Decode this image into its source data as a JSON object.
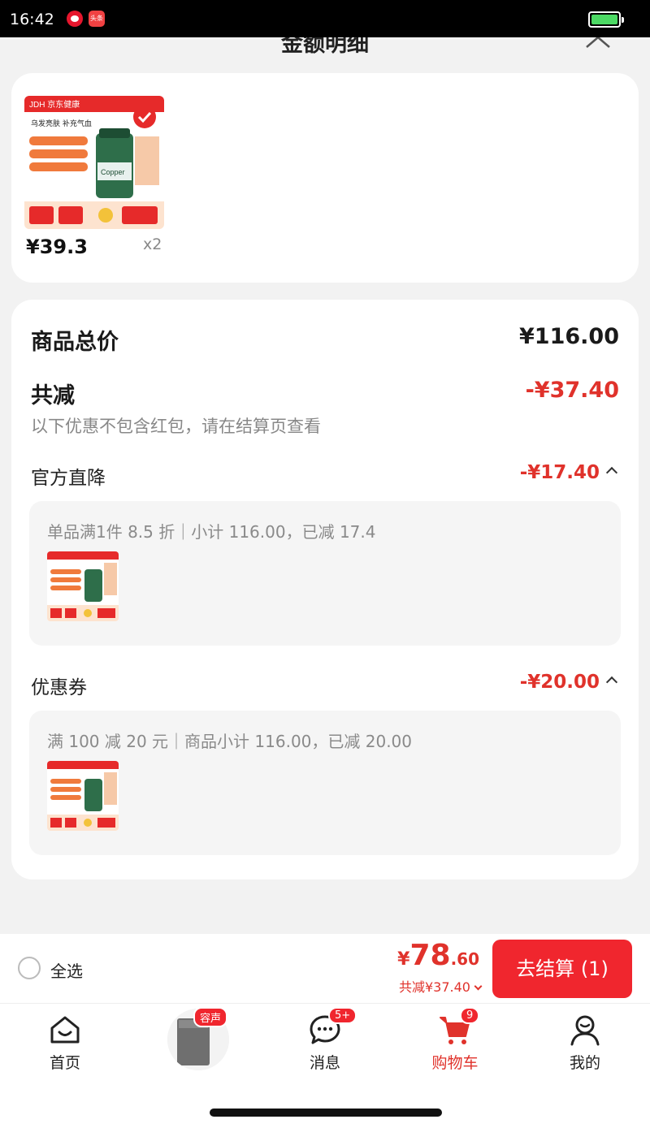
{
  "status_bar": {
    "time": "16:42",
    "toutiao_label": "头条"
  },
  "header": {
    "title": "金额明细"
  },
  "product": {
    "brand_line": "JDH 京东健康",
    "tagline": "乌发亮肤 补充气血",
    "bottle_label": "Copper",
    "price": "¥39.3",
    "quantity": "x2"
  },
  "summary": {
    "total_label": "商品总价",
    "total_value": "¥116.00",
    "discount_label": "共减",
    "discount_value": "-¥37.40",
    "note": "以下优惠不包含红包，请在结算页查看"
  },
  "official_discount": {
    "label": "官方直降",
    "value": "-¥17.40",
    "detail": "单品满1件 8.5 折｜小计 116.00，已减 17.4"
  },
  "coupon": {
    "label": "优惠券",
    "value": "-¥20.00",
    "detail": "满 100 减 20 元｜商品小计 116.00，已减 20.00"
  },
  "checkout": {
    "select_all_label": "全选",
    "currency": "¥",
    "price_int": "78",
    "price_dec": ".60",
    "discount_text": "共减¥37.40",
    "button_label": "去结算 (1)"
  },
  "tabs": [
    {
      "label": "首页",
      "icon": "home-icon"
    },
    {
      "label": "容声",
      "icon": "promo-product",
      "badge": "容声"
    },
    {
      "label": "消息",
      "icon": "message-icon",
      "badge": "5+"
    },
    {
      "label": "购物车",
      "icon": "cart-icon",
      "badge": "9",
      "active": true
    },
    {
      "label": "我的",
      "icon": "profile-icon"
    }
  ],
  "colors": {
    "accent": "#e0322b",
    "button": "#f0262e",
    "background": "#f2f2f2"
  }
}
